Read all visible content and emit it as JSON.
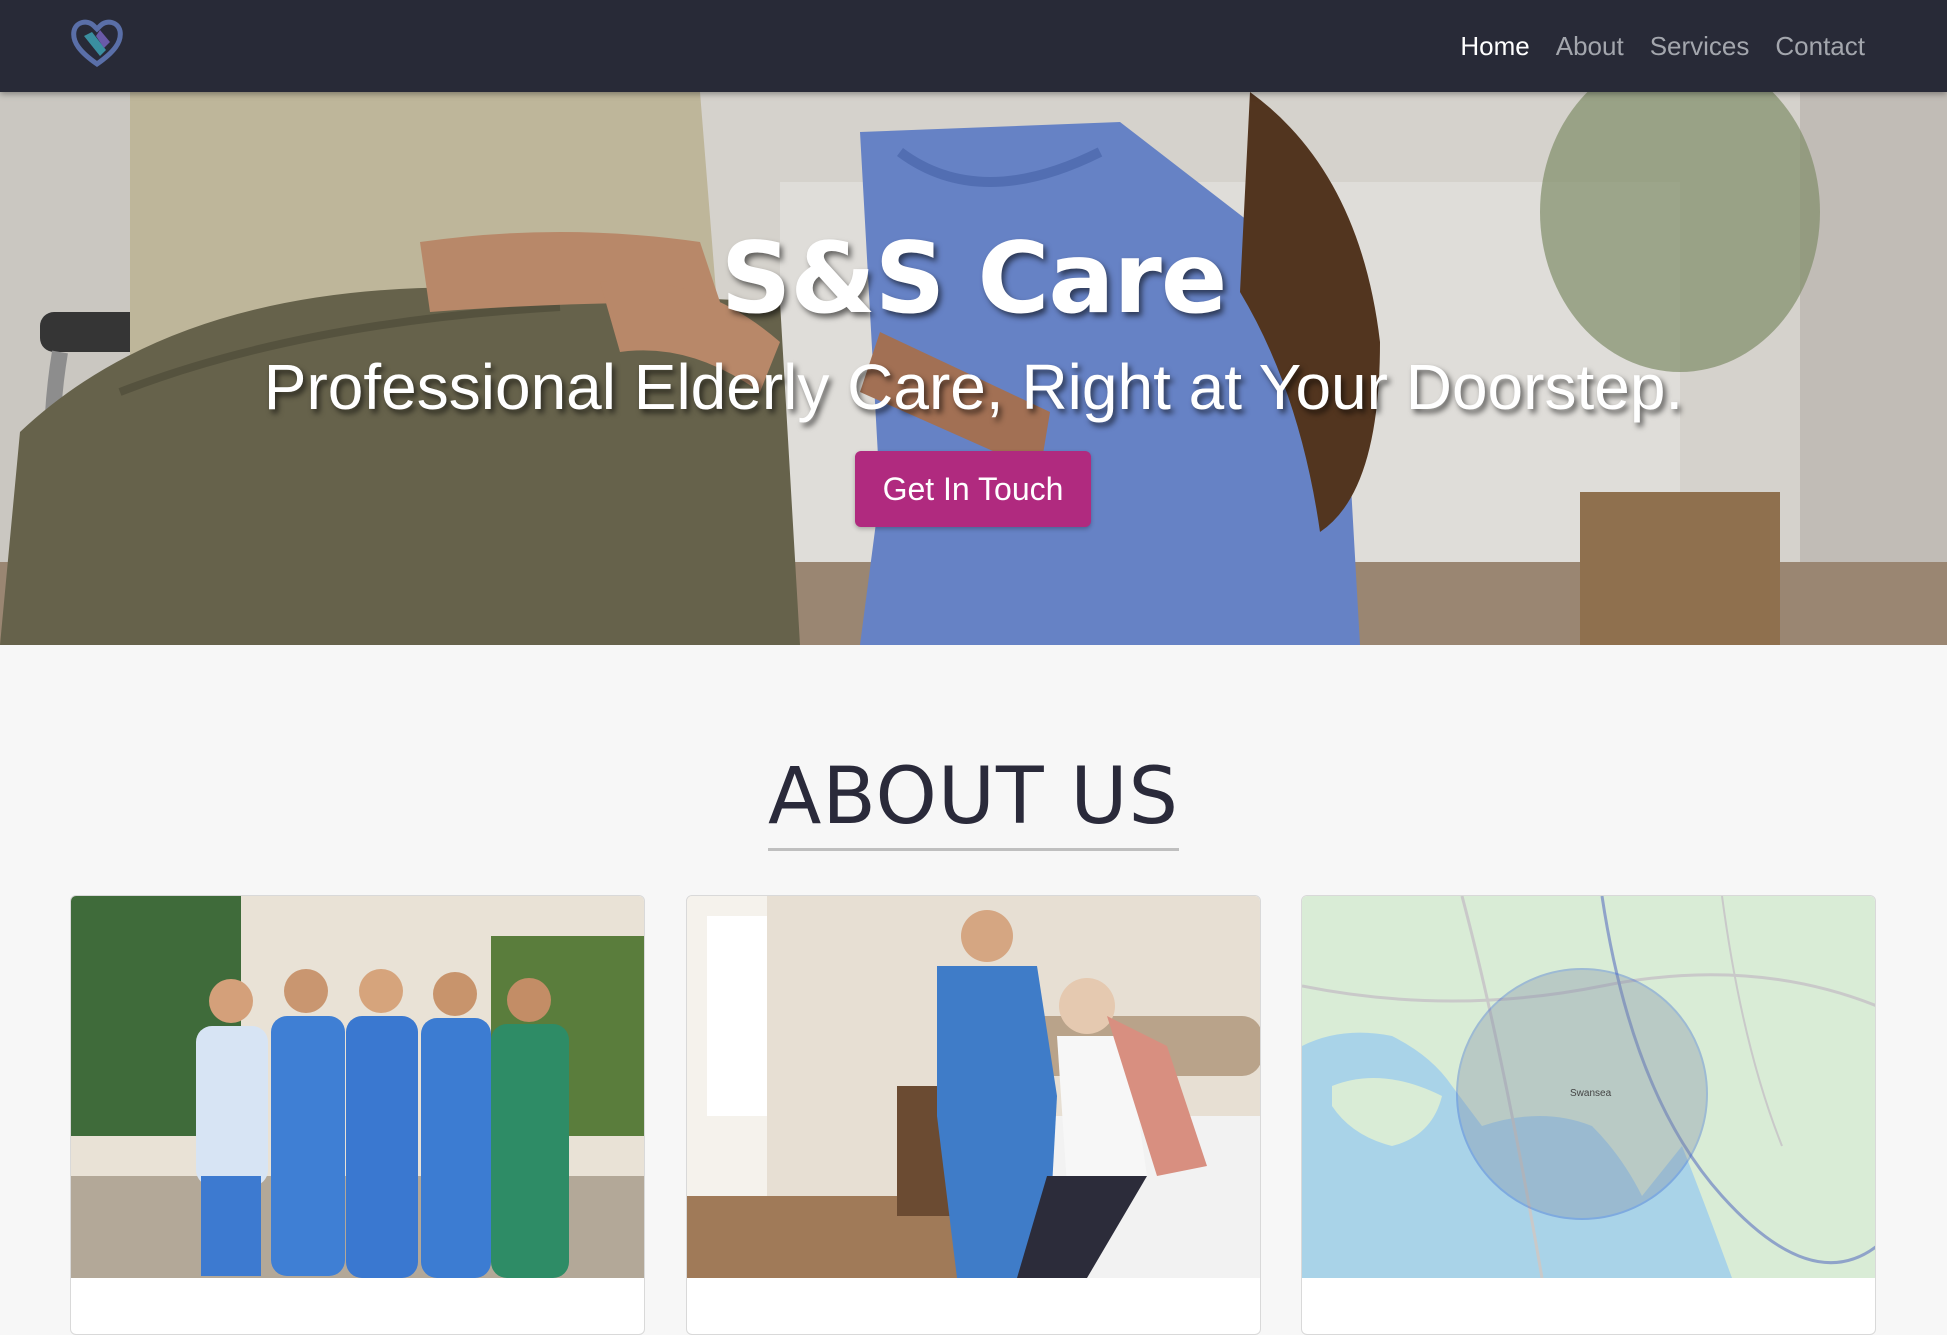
{
  "nav": {
    "logo_icon": "heart-logo-icon",
    "links": [
      {
        "label": "Home",
        "active": true
      },
      {
        "label": "About",
        "active": false
      },
      {
        "label": "Services",
        "active": false
      },
      {
        "label": "Contact",
        "active": false
      }
    ]
  },
  "hero": {
    "title": "S&S Care",
    "subtitle": "Professional Elderly Care, Right at Your Doorstep.",
    "cta_label": "Get In Touch"
  },
  "about": {
    "heading": "ABOUT US",
    "cards": [
      {
        "image": "care-team-photo",
        "title": ""
      },
      {
        "image": "caregiver-helping-elderly-photo",
        "title": ""
      },
      {
        "image": "service-area-map",
        "title": ""
      }
    ],
    "map_labels": [
      "Swansea"
    ]
  },
  "colors": {
    "navbar_bg": "#282a37",
    "accent": "#b02a7f",
    "heading": "#2a2a3a"
  }
}
